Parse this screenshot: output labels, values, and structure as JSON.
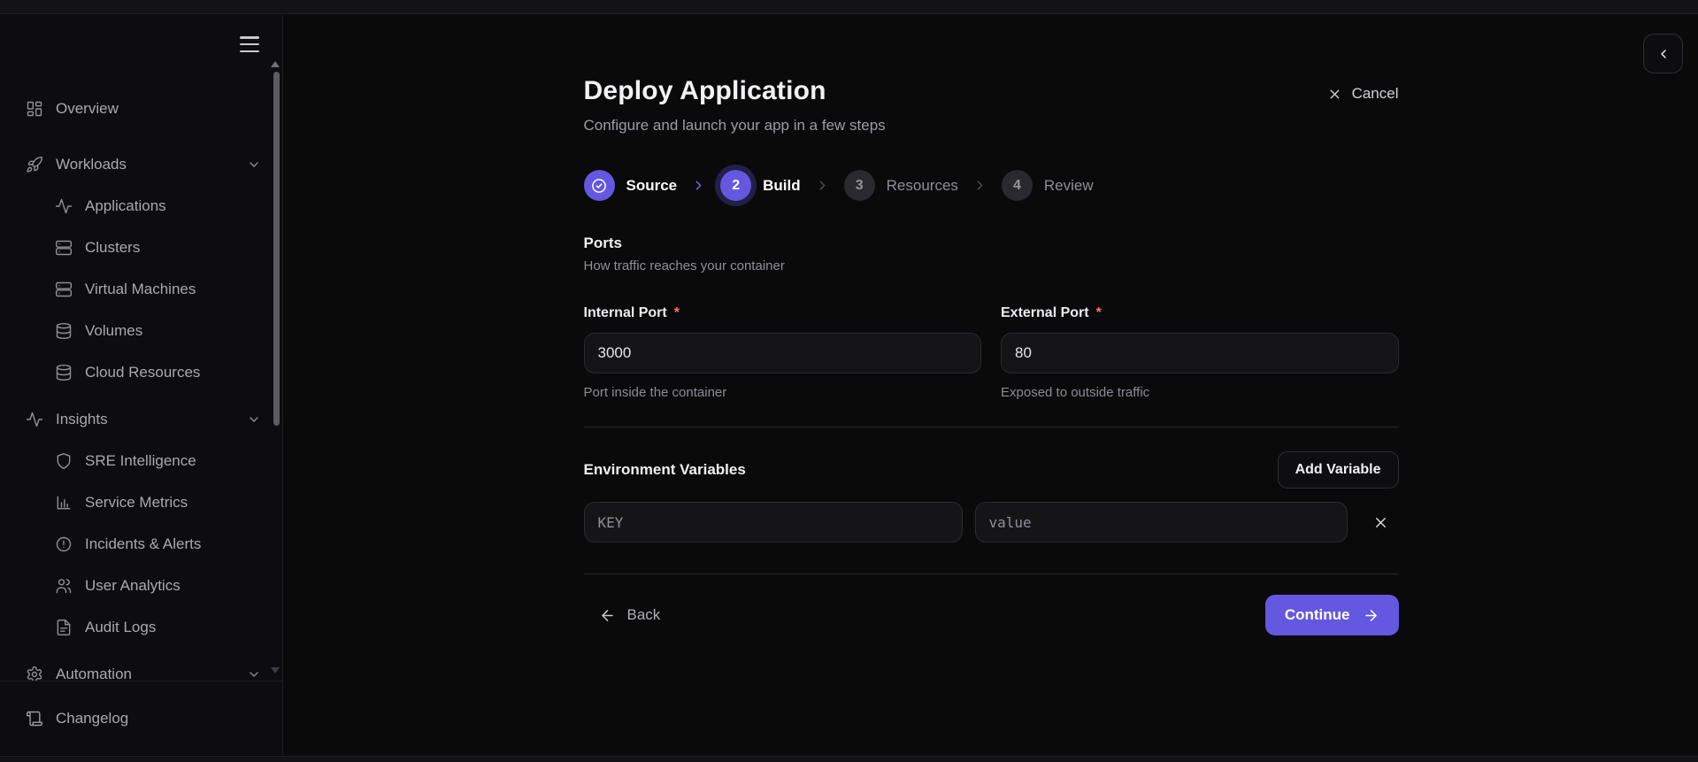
{
  "sidebar": {
    "items": [
      {
        "label": "Overview"
      },
      {
        "label": "Workloads"
      },
      {
        "label": "Applications"
      },
      {
        "label": "Clusters"
      },
      {
        "label": "Virtual Machines"
      },
      {
        "label": "Volumes"
      },
      {
        "label": "Cloud Resources"
      },
      {
        "label": "Insights"
      },
      {
        "label": "SRE Intelligence"
      },
      {
        "label": "Service Metrics"
      },
      {
        "label": "Incidents & Alerts"
      },
      {
        "label": "User Analytics"
      },
      {
        "label": "Audit Logs"
      },
      {
        "label": "Automation"
      }
    ],
    "footer_item": {
      "label": "Changelog"
    }
  },
  "header": {
    "title": "Deploy Application",
    "subtitle": "Configure and launch your app in a few steps",
    "cancel_label": "Cancel"
  },
  "stepper": {
    "steps": [
      {
        "number": "1",
        "label": "Source",
        "state": "complete"
      },
      {
        "number": "2",
        "label": "Build",
        "state": "active"
      },
      {
        "number": "3",
        "label": "Resources",
        "state": "upcoming"
      },
      {
        "number": "4",
        "label": "Review",
        "state": "upcoming"
      }
    ]
  },
  "ports": {
    "heading": "Ports",
    "description": "How traffic reaches your container",
    "internal": {
      "label": "Internal Port",
      "required": "*",
      "value": "3000",
      "helper": "Port inside the container"
    },
    "external": {
      "label": "External Port",
      "required": "*",
      "value": "80",
      "helper": "Exposed to outside traffic"
    }
  },
  "env": {
    "heading": "Environment Variables",
    "add_button": "Add Variable",
    "rows": [
      {
        "key_placeholder": "KEY",
        "value_placeholder": "value"
      }
    ]
  },
  "footer": {
    "back_label": "Back",
    "continue_label": "Continue"
  },
  "colors": {
    "accent": "#6458e0",
    "accent_ring": "#232047",
    "required": "#f87171",
    "page_bg": "#0a0a0b",
    "sidebar_bg": "#0d0d0f",
    "input_bg": "#141417",
    "border": "#29292e"
  }
}
